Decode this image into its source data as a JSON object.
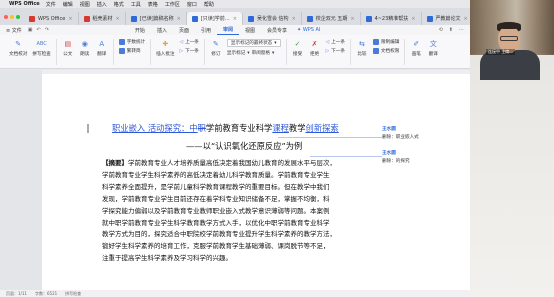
{
  "menubar": {
    "app": "WPS Office",
    "items": [
      "文件",
      "编辑",
      "视图",
      "插入",
      "格式",
      "工具",
      "表格",
      "工作区",
      "窗口",
      "帮助"
    ]
  },
  "tabs": [
    {
      "label": "WPS Office",
      "color": "#d8392e"
    },
    {
      "label": "稻壳素材",
      "color": "#d8392e"
    },
    {
      "label": "[已读]篇稿名称",
      "color": "#2f6ad9"
    },
    {
      "label": "[只读]学前…",
      "color": "#2f6ad9",
      "active": true
    },
    {
      "label": "吴化雪会 信构",
      "color": "#2f6ad9"
    },
    {
      "label": "校企双元 五期",
      "color": "#2f6ad9"
    },
    {
      "label": "4~23精准帮扶",
      "color": "#2f6ad9"
    },
    {
      "label": "严教篇论文",
      "color": "#2f6ad9"
    }
  ],
  "ribbon": {
    "file_menu": "≡ 文件",
    "tabs": [
      "开始",
      "插入",
      "页面",
      "引用",
      "审阅",
      "视图",
      "会员专享"
    ],
    "active_tab": "审阅",
    "ai": "WPS AI",
    "right_tools": [
      "⟲",
      "⬆",
      "⋯"
    ]
  },
  "toolbar": {
    "groups": [
      {
        "items": [
          {
            "label": "文档校对",
            "icon": "✎",
            "color": "#4a7bd9"
          },
          {
            "label": "拼写检查",
            "icon": "ABC",
            "color": "#4a7bd9"
          }
        ]
      },
      {
        "items": [
          {
            "label": "公文",
            "icon": "▤",
            "color": "#c44"
          },
          {
            "label": "朗读",
            "icon": "◉",
            "color": "#4a7bd9"
          },
          {
            "label": "翻译",
            "icon": "A",
            "color": "#4a7bd9"
          }
        ]
      },
      {
        "items": [
          {
            "label": "字数统计",
            "icon": "#",
            "color": "#4a7bd9"
          },
          {
            "label": "繁转简",
            "icon": "繁",
            "color": "#4a7bd9"
          }
        ]
      },
      {
        "items": [
          {
            "label": "插入批注",
            "icon": "✚",
            "color": "#e6a23c"
          },
          {
            "label": "上一条",
            "icon": "◁",
            "color": "#4a7bd9"
          },
          {
            "label": "下一条",
            "icon": "▷",
            "color": "#4a7bd9"
          }
        ]
      },
      {
        "items": [
          {
            "label": "修订",
            "icon": "✎",
            "color": "#4a7bd9"
          }
        ]
      },
      {
        "items": [
          {
            "label": "显示标记的最终状态",
            "dropdown": true
          },
          {
            "label": "显示标记",
            "dropdown": true
          },
          {
            "label": "审阅窗格",
            "dropdown": true
          }
        ]
      },
      {
        "items": [
          {
            "label": "接受",
            "icon": "✓",
            "color": "#3a9a4a"
          },
          {
            "label": "拒绝",
            "icon": "✗",
            "color": "#d8392e"
          }
        ]
      },
      {
        "items": [
          {
            "label": "上一条",
            "icon": "◁",
            "color": "#4a7bd9"
          },
          {
            "label": "下一条",
            "icon": "▷",
            "color": "#4a7bd9"
          }
        ]
      },
      {
        "items": [
          {
            "label": "比较",
            "icon": "⇆",
            "color": "#4a7bd9"
          },
          {
            "label": "限制编辑",
            "icon": "🔒",
            "color": "#4a7bd9"
          },
          {
            "label": "文档权限",
            "icon": "⚿",
            "color": "#4a7bd9"
          }
        ]
      },
      {
        "items": [
          {
            "label": "画笔",
            "icon": "✐",
            "color": "#4a7bd9"
          },
          {
            "label": "翻译",
            "icon": "文",
            "color": "#4a7bd9"
          }
        ]
      }
    ]
  },
  "document": {
    "title_parts": [
      {
        "text": "职业嵌入 活动探究：中",
        "style": "ins"
      },
      {
        "text": "职",
        "style": "del"
      },
      {
        "text": "学前教育专业科学",
        "style": "normal"
      },
      {
        "text": "课程",
        "style": "ins"
      },
      {
        "text": "教学",
        "style": "normal"
      },
      {
        "text": "创新探索",
        "style": "ins"
      }
    ],
    "subtitle": "——以“认识氧化还原反应”为例",
    "abstract_label": "【摘要】",
    "abstract_lines": [
      "学前教育专业人才培养质量高低决定着我国幼儿教育的发展水平与层次，",
      "学前教育专业学生科学素养的高低决定着幼儿科学教育质量。学前教育专业学生",
      "科学素养全面提升，是学前儿童科学教育课程教学的重要目标。但在教学中我们",
      "发现，学前教育专业学生目前还存在着学科专业知识储备不足，掌握不均衡，科",
      "学探究能力偏弱以及学前教育专业教师职业嵌入式教学意识薄弱等问题。本案例",
      "就中职学前教育专业学生科学教育教学方式入手，以优化中职学前教育专业科学",
      "教学方式为目的，探究适合中职院校学前教育专业提升学生科学素养的教学方法，",
      "锻好学生科学素养的培育工作，克服学前教育学生基础薄弱、课岗脱节等不足，",
      "注重于提高学生科学素养及学习科学的兴趣。"
    ]
  },
  "comments": [
    {
      "author": "王水圆",
      "text": "删除：职业嵌入式"
    },
    {
      "author": "王水圆",
      "text": "删除：的探究"
    }
  ],
  "status": {
    "page": "页面：1/11",
    "words": "字数：6521",
    "mode": "拼写检查"
  },
  "video": {
    "name": "连接中 主席…"
  }
}
